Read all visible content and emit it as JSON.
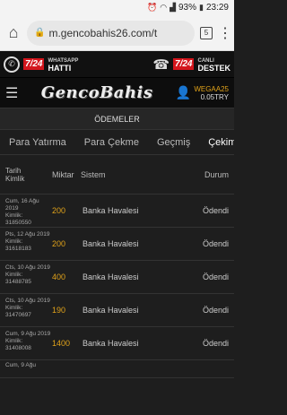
{
  "statusbar": {
    "battery": "93%",
    "time": "23:29"
  },
  "browser": {
    "url": "m.gencobahis26.com/t",
    "tab_count": "5"
  },
  "banner": {
    "left_badge": "7/24",
    "left_title": "HATTI",
    "left_sub": "WHATSAPP",
    "right_badge": "7/24",
    "right_title": "DESTEK",
    "right_sub": "CANLI"
  },
  "header": {
    "logo": "GencoBahis",
    "username": "WEGAA25",
    "balance": "0.05TRY"
  },
  "section_title": "ÖDEMELER",
  "tabs": [
    "Para Yatırma",
    "Para Çekme",
    "Geçmiş",
    "Çekim d"
  ],
  "table": {
    "headers": {
      "date": "Tarih",
      "id": "Kimlik",
      "amount": "Miktar",
      "system": "Sistem",
      "status": "Durum"
    },
    "rows": [
      {
        "date": "Cum, 16 Ağu 2019",
        "kimlik_label": "Kimlik:",
        "kimlik": "31850550",
        "amount": "200",
        "system": "Banka Havalesi",
        "status": "Ödendi"
      },
      {
        "date": "Pts, 12 Ağu 2019",
        "kimlik_label": "Kimlik:",
        "kimlik": "31618183",
        "amount": "200",
        "system": "Banka Havalesi",
        "status": "Ödendi"
      },
      {
        "date": "Cts, 10 Ağu 2019",
        "kimlik_label": "Kimlik:",
        "kimlik": "31488785",
        "amount": "400",
        "system": "Banka Havalesi",
        "status": "Ödendi"
      },
      {
        "date": "Cts, 10 Ağu 2019",
        "kimlik_label": "Kimlik:",
        "kimlik": "31470697",
        "amount": "190",
        "system": "Banka Havalesi",
        "status": "Ödendi"
      },
      {
        "date": "Cum, 9 Ağu 2019",
        "kimlik_label": "Kimlik:",
        "kimlik": "31408008",
        "amount": "1400",
        "system": "Banka Havalesi",
        "status": "Ödendi"
      },
      {
        "date": "Cum, 9 Ağu",
        "kimlik_label": "",
        "kimlik": "",
        "amount": "",
        "system": "",
        "status": ""
      }
    ]
  }
}
